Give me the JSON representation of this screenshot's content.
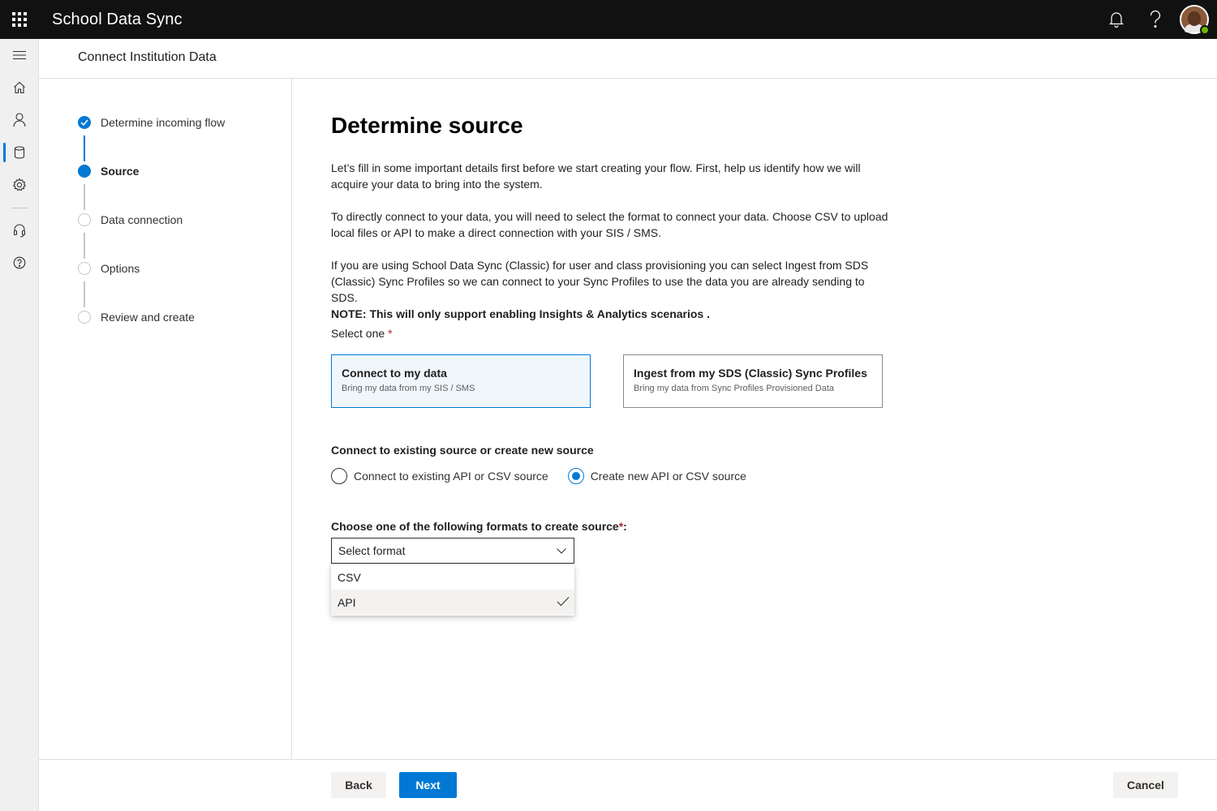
{
  "app": {
    "title": "School Data Sync"
  },
  "header": {
    "title": "Connect Institution Data"
  },
  "rail": {
    "items": [
      {
        "icon": "hamburger-menu-icon"
      },
      {
        "icon": "home-icon"
      },
      {
        "icon": "person-icon"
      },
      {
        "icon": "database-icon",
        "active": true
      },
      {
        "icon": "gear-icon"
      },
      {
        "icon": "headset-icon"
      },
      {
        "icon": "help-circle-icon"
      }
    ]
  },
  "topbar": {
    "icons": [
      "bell-icon",
      "question-icon",
      "avatar"
    ]
  },
  "steps": [
    {
      "label": "Determine incoming flow",
      "state": "done"
    },
    {
      "label": "Source",
      "state": "current"
    },
    {
      "label": "Data connection",
      "state": "pending"
    },
    {
      "label": "Options",
      "state": "pending"
    },
    {
      "label": "Review and create",
      "state": "pending"
    }
  ],
  "main": {
    "title": "Determine source",
    "para1": "Let’s fill in some important details first before we start creating your flow. First, help us identify how we will acquire your data to bring into the system.",
    "para2": "To directly connect to your data, you will need to select the format to connect your data. Choose CSV to upload local files or API to make a direct connection with your SIS / SMS.",
    "para3": "If you are using School Data Sync (Classic) for user and class provisioning you can select Ingest from SDS (Classic) Sync Profiles so we can connect to your Sync Profiles to use the data you are already sending to SDS.",
    "note": "NOTE: This will only support enabling Insights & Analytics scenarios .",
    "select_one_label": "Select one",
    "required_mark": "*",
    "cards": [
      {
        "title": "Connect to my data",
        "subtitle": "Bring my data from my SIS / SMS",
        "selected": true
      },
      {
        "title": "Ingest from my SDS (Classic) Sync Profiles",
        "subtitle": "Bring my data from Sync Profiles Provisioned Data",
        "selected": false
      }
    ],
    "connect_label": "Connect to existing source or create new source",
    "radios": [
      {
        "label": "Connect to existing API or CSV source",
        "checked": false
      },
      {
        "label": "Create new API or CSV source",
        "checked": true
      }
    ],
    "format_label": "Choose one of the following formats to create source",
    "format_label_suffix": ":",
    "select": {
      "placeholder": "Select format",
      "options": [
        "CSV",
        "API"
      ],
      "selected_option": "API"
    }
  },
  "footer": {
    "back": "Back",
    "next": "Next",
    "cancel": "Cancel"
  },
  "colors": {
    "accent": "#0078d4",
    "topbar": "#111111",
    "required": "#a4262c",
    "presence": "#6bb700"
  }
}
